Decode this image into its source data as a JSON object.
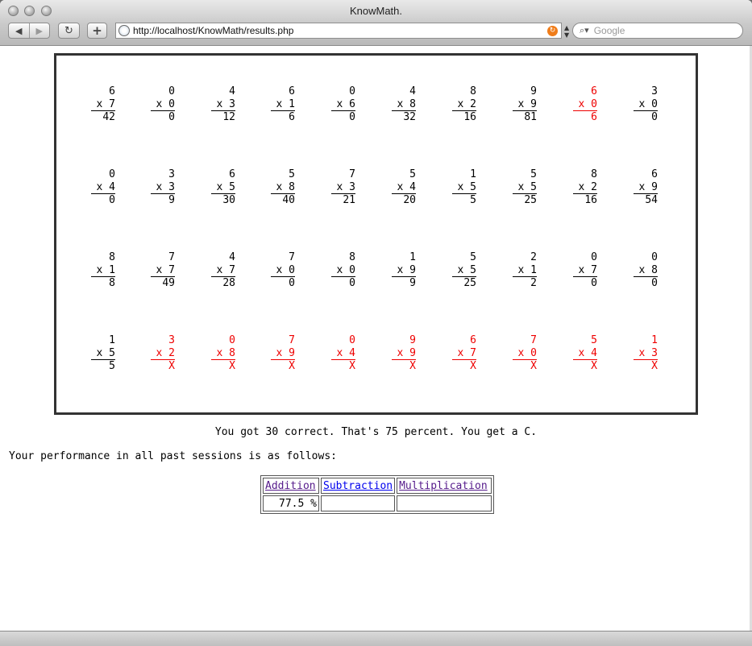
{
  "window": {
    "title": "KnowMath."
  },
  "toolbar": {
    "back_icon": "back-arrow-icon",
    "forward_icon": "forward-arrow-icon",
    "reload_icon": "reload-icon",
    "add_icon": "plus-icon",
    "url": "http://localhost/KnowMath/results.php",
    "search_placeholder": "Google"
  },
  "problems": [
    [
      {
        "a": "6",
        "b": "x 7",
        "ans": "42",
        "ok": true
      },
      {
        "a": "0",
        "b": "x 0",
        "ans": "0",
        "ok": true
      },
      {
        "a": "4",
        "b": "x 3",
        "ans": "12",
        "ok": true
      },
      {
        "a": "6",
        "b": "x 1",
        "ans": "6",
        "ok": true
      },
      {
        "a": "0",
        "b": "x 6",
        "ans": "0",
        "ok": true
      },
      {
        "a": "4",
        "b": "x 8",
        "ans": "32",
        "ok": true
      },
      {
        "a": "8",
        "b": "x 2",
        "ans": "16",
        "ok": true
      },
      {
        "a": "9",
        "b": "x 9",
        "ans": "81",
        "ok": true
      },
      {
        "a": "6",
        "b": "x 0",
        "ans": "6",
        "ok": false
      },
      {
        "a": "3",
        "b": "x 0",
        "ans": "0",
        "ok": true
      }
    ],
    [
      {
        "a": "0",
        "b": "x 4",
        "ans": "0",
        "ok": true
      },
      {
        "a": "3",
        "b": "x 3",
        "ans": "9",
        "ok": true
      },
      {
        "a": "6",
        "b": "x 5",
        "ans": "30",
        "ok": true
      },
      {
        "a": "5",
        "b": "x 8",
        "ans": "40",
        "ok": true
      },
      {
        "a": "7",
        "b": "x 3",
        "ans": "21",
        "ok": true
      },
      {
        "a": "5",
        "b": "x 4",
        "ans": "20",
        "ok": true
      },
      {
        "a": "1",
        "b": "x 5",
        "ans": "5",
        "ok": true
      },
      {
        "a": "5",
        "b": "x 5",
        "ans": "25",
        "ok": true
      },
      {
        "a": "8",
        "b": "x 2",
        "ans": "16",
        "ok": true
      },
      {
        "a": "6",
        "b": "x 9",
        "ans": "54",
        "ok": true
      }
    ],
    [
      {
        "a": "8",
        "b": "x 1",
        "ans": "8",
        "ok": true
      },
      {
        "a": "7",
        "b": "x 7",
        "ans": "49",
        "ok": true
      },
      {
        "a": "4",
        "b": "x 7",
        "ans": "28",
        "ok": true
      },
      {
        "a": "7",
        "b": "x 0",
        "ans": "0",
        "ok": true
      },
      {
        "a": "8",
        "b": "x 0",
        "ans": "0",
        "ok": true
      },
      {
        "a": "1",
        "b": "x 9",
        "ans": "9",
        "ok": true
      },
      {
        "a": "5",
        "b": "x 5",
        "ans": "25",
        "ok": true
      },
      {
        "a": "2",
        "b": "x 1",
        "ans": "2",
        "ok": true
      },
      {
        "a": "0",
        "b": "x 7",
        "ans": "0",
        "ok": true
      },
      {
        "a": "0",
        "b": "x 8",
        "ans": "0",
        "ok": true
      }
    ],
    [
      {
        "a": "1",
        "b": "x 5",
        "ans": "5",
        "ok": true
      },
      {
        "a": "3",
        "b": "x 2",
        "ans": "X",
        "ok": false
      },
      {
        "a": "0",
        "b": "x 8",
        "ans": "X",
        "ok": false
      },
      {
        "a": "7",
        "b": "x 9",
        "ans": "X",
        "ok": false
      },
      {
        "a": "0",
        "b": "x 4",
        "ans": "X",
        "ok": false
      },
      {
        "a": "9",
        "b": "x 9",
        "ans": "X",
        "ok": false
      },
      {
        "a": "6",
        "b": "x 7",
        "ans": "X",
        "ok": false
      },
      {
        "a": "7",
        "b": "x 0",
        "ans": "X",
        "ok": false
      },
      {
        "a": "5",
        "b": "x 4",
        "ans": "X",
        "ok": false
      },
      {
        "a": "1",
        "b": "x 3",
        "ans": "X",
        "ok": false
      }
    ]
  ],
  "colors": {
    "wrong": "#e00000",
    "visited_link": "#551a8b",
    "link": "#0000ee"
  },
  "result_text": "You got 30 correct. That's 75 percent. You get a C.",
  "performance_text": "Your performance in all past sessions is as follows:",
  "history": {
    "headers": [
      "Addition",
      "Subtraction",
      "Multiplication"
    ],
    "values": [
      "77.5 %",
      "",
      ""
    ]
  }
}
